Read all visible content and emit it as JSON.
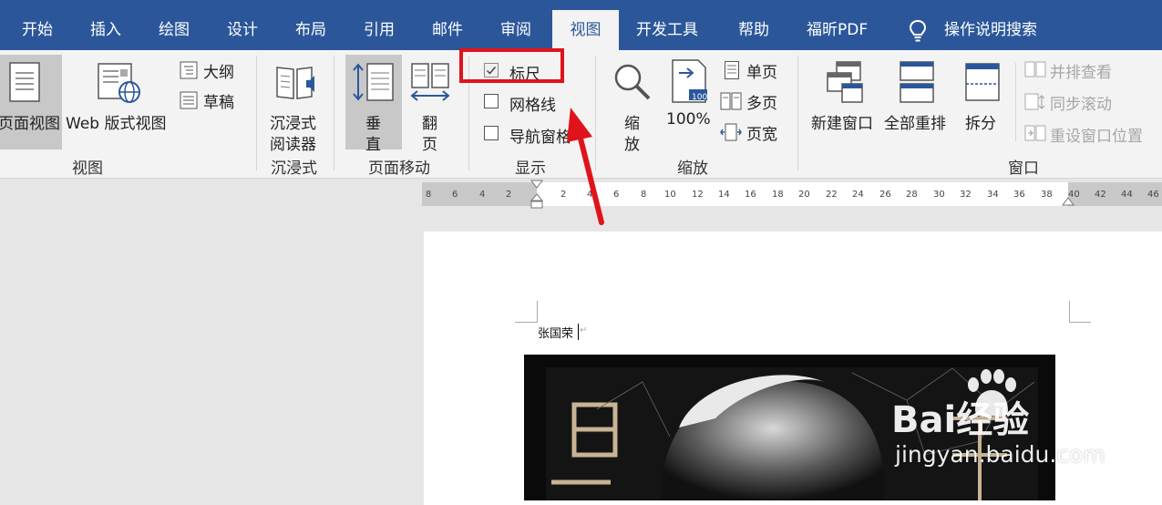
{
  "tabs": [
    "开始",
    "插入",
    "绘图",
    "设计",
    "布局",
    "引用",
    "邮件",
    "审阅",
    "视图",
    "开发工具",
    "帮助",
    "福昕PDF"
  ],
  "active_tab": "视图",
  "tell_me": "操作说明搜索",
  "views": {
    "print_layout": "页面视图",
    "web_layout": "Web 版式视图",
    "outline": "大纲",
    "draft": "草稿",
    "group": "视图"
  },
  "immersive": {
    "reader_line1": "沉浸式",
    "reader_line2": "阅读器",
    "group": "沉浸式"
  },
  "page_move": {
    "vertical_l1": "垂",
    "vertical_l2": "直",
    "flip_l1": "翻",
    "flip_l2": "页",
    "group": "页面移动"
  },
  "show": {
    "ruler": "标尺",
    "ruler_checked": true,
    "gridlines": "网格线",
    "gridlines_checked": false,
    "navpane": "导航窗格",
    "navpane_checked": false,
    "group": "显示"
  },
  "zoom": {
    "zoom_l1": "缩",
    "zoom_l2": "放",
    "percent": "100%",
    "one_page": "单页",
    "multi_page": "多页",
    "page_width": "页宽",
    "group": "缩放",
    "icon_badge": "100"
  },
  "window": {
    "new_window": "新建窗口",
    "arrange_all": "全部重排",
    "split": "拆分",
    "side_by_side": "并排查看",
    "sync_scroll": "同步滚动",
    "reset_pos": "重设窗口位置",
    "group": "窗口"
  },
  "ruler_ticks": [
    "8",
    "6",
    "4",
    "2",
    "2",
    "4",
    "6",
    "8",
    "10",
    "12",
    "14",
    "16",
    "18",
    "20",
    "22",
    "24",
    "26",
    "28",
    "30",
    "32",
    "34",
    "36",
    "38",
    "40",
    "42",
    "44",
    "46"
  ],
  "document": {
    "text": "张国荣"
  },
  "watermark": {
    "brand": "Bai经验",
    "url": "jingyan.baidu.com"
  },
  "colors": {
    "accent": "#2b579a",
    "highlight": "#e0131b"
  }
}
